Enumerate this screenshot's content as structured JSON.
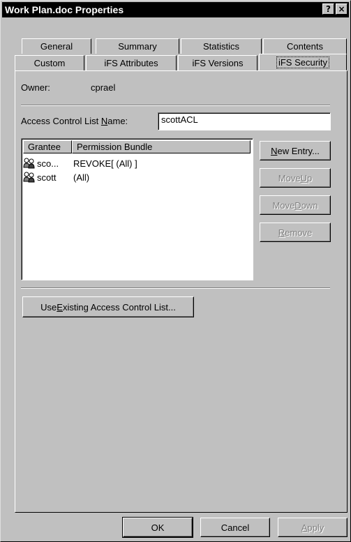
{
  "window": {
    "title": "Work Plan.doc Properties",
    "help_button": "?",
    "close_button": "×"
  },
  "tabs": {
    "row_back": [
      {
        "label": "General"
      },
      {
        "label": "Summary"
      },
      {
        "label": "Statistics"
      },
      {
        "label": "Contents"
      }
    ],
    "row_front": [
      {
        "label": "Custom"
      },
      {
        "label": "iFS Attributes"
      },
      {
        "label": "iFS Versions"
      },
      {
        "label": "iFS Security",
        "active": true
      }
    ]
  },
  "owner": {
    "label": "Owner:",
    "value": "cprael"
  },
  "acl": {
    "label_pre": "Access Control List ",
    "label_accel": "N",
    "label_post": "ame:",
    "value": "scottACL"
  },
  "list": {
    "columns": [
      "Grantee",
      "Permission Bundle"
    ],
    "rows": [
      {
        "grantee": "sco...",
        "permission": "REVOKE[ (All) ]",
        "icon": "user-group-icon"
      },
      {
        "grantee": "scott",
        "permission": "(All)",
        "icon": "user-group-icon"
      }
    ]
  },
  "side_buttons": {
    "new_entry": {
      "pre": "",
      "accel": "N",
      "post": "ew Entry..."
    },
    "move_up": {
      "pre": "Move ",
      "accel": "U",
      "post": "p"
    },
    "move_down": {
      "pre": "Move ",
      "accel": "D",
      "post": "own"
    },
    "remove": {
      "pre": "",
      "accel": "R",
      "post": "emove"
    }
  },
  "use_existing": {
    "pre": "Use ",
    "accel": "E",
    "post": "xisting Access Control List..."
  },
  "footer": {
    "ok": "OK",
    "cancel": "Cancel",
    "apply": {
      "pre": "",
      "accel": "A",
      "post": "pply"
    }
  }
}
